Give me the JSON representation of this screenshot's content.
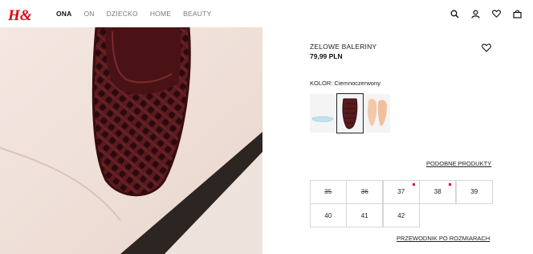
{
  "header": {
    "logo_text": "H&M",
    "nav": [
      {
        "label": "ONA",
        "active": true
      },
      {
        "label": "ON",
        "active": false
      },
      {
        "label": "DZIECKO",
        "active": false
      },
      {
        "label": "HOME",
        "active": false
      },
      {
        "label": "BEAUTY",
        "active": false
      }
    ],
    "icons": [
      "search-icon",
      "account-icon",
      "favorites-icon",
      "bag-icon"
    ]
  },
  "product": {
    "title": "ŻELOWE BALERINY",
    "price": "79,99 PLN",
    "color_key": "KOLOR:",
    "color_value": "Ciemnoczerwony",
    "swatches": [
      {
        "name": "light-blue",
        "color": "#bfe3f0"
      },
      {
        "name": "dark-red",
        "color": "#5a1a1e",
        "selected": true
      },
      {
        "name": "peach",
        "color": "#f2c8a8"
      }
    ],
    "similar_label": "PODOBNE PRODUKTY",
    "sizes": [
      {
        "label": "35",
        "out_of_stock": true,
        "low_stock": false
      },
      {
        "label": "36",
        "out_of_stock": true,
        "low_stock": false
      },
      {
        "label": "37",
        "out_of_stock": false,
        "low_stock": true
      },
      {
        "label": "38",
        "out_of_stock": false,
        "low_stock": true
      },
      {
        "label": "39",
        "out_of_stock": false,
        "low_stock": false
      },
      {
        "label": "40",
        "out_of_stock": false,
        "low_stock": false
      },
      {
        "label": "41",
        "out_of_stock": false,
        "low_stock": false
      },
      {
        "label": "42",
        "out_of_stock": false,
        "low_stock": false
      }
    ],
    "size_guide_label": "PRZEWODNIK PO ROZMIARACH"
  },
  "colors": {
    "brand_red": "#e50010",
    "low_stock_red": "#e5002b",
    "shoe": "#5a1a1e"
  }
}
